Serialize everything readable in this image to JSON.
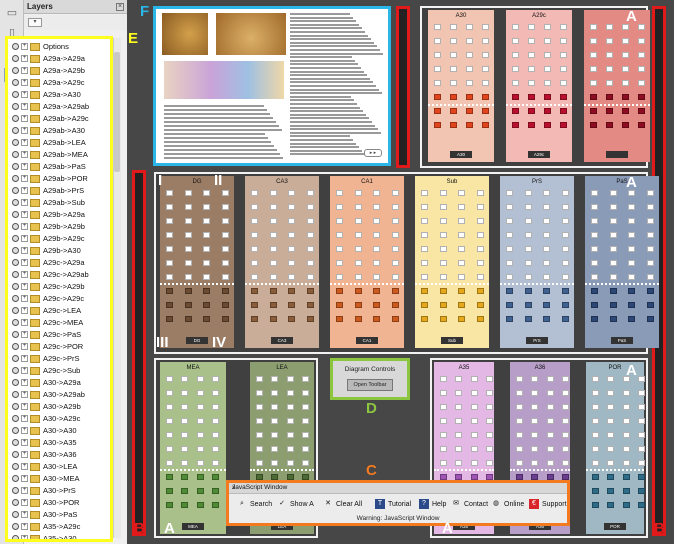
{
  "layers_panel": {
    "title": "Layers",
    "close": "×",
    "options_icon": "options-menu-icon",
    "items": [
      "Options",
      "A29a->A29a",
      "A29a->A29b",
      "A29a->A29c",
      "A29a->A30",
      "A29a->A29ab",
      "A29ab->A29c",
      "A29ab->A30",
      "A29ab->LEA",
      "A29ab->MEA",
      "A29ab->PaS",
      "A29ab->POR",
      "A29ab->PrS",
      "A29ab->Sub",
      "A29b->A29a",
      "A29b->A29b",
      "A29b->A29c",
      "A29b->A30",
      "A29c->A29a",
      "A29c->A29ab",
      "A29c->A29b",
      "A29c->A29c",
      "A29c->LEA",
      "A29c->MEA",
      "A29c->PaS",
      "A29c->POR",
      "A29c->PrS",
      "A29c->Sub",
      "A30->A29a",
      "A30->A29ab",
      "A30->A29b",
      "A30->A29c",
      "A30->A30",
      "A30->A35",
      "A30->A36",
      "A30->LEA",
      "A30->MEA",
      "A30->PrS",
      "A30->POR",
      "A30->PaS",
      "A35->A29c",
      "A35->A30"
    ]
  },
  "annotations": {
    "E": "E",
    "F": "F",
    "A": "A",
    "B": "B",
    "C": "C",
    "D": "D",
    "I": "I",
    "II": "II",
    "III": "III",
    "IV": "IV"
  },
  "columns_top": [
    {
      "label": "A30",
      "color": "#f2c4b2",
      "cell": "#e0451e"
    },
    {
      "label": "A29c",
      "color": "#f3b9b4",
      "cell": "#b8102d"
    },
    {
      "label": "",
      "color": "#e38a85",
      "cell": "#8e0d20"
    }
  ],
  "columns_mid": [
    {
      "label": "DG",
      "color": "#9b7d66",
      "cell": "#6b4a32"
    },
    {
      "label": "CA3",
      "color": "#c9ad98",
      "cell": "#8a5d3a"
    },
    {
      "label": "CA1",
      "color": "#f0b493",
      "cell": "#cc5a1e"
    },
    {
      "label": "Sub",
      "color": "#f9e6a4",
      "cell": "#e5a81c"
    },
    {
      "label": "PrS",
      "color": "#b3bfd2",
      "cell": "#40618f"
    },
    {
      "label": "PaS",
      "color": "#8a9bb8",
      "cell": "#2c4776"
    }
  ],
  "columns_bottom": [
    {
      "label": "MEA",
      "color": "#a9c08a",
      "cell": "#4f8a35"
    },
    {
      "label": "LEA",
      "color": "#8c9e70",
      "cell": "#4c6a33"
    },
    {
      "label": "A35",
      "color": "#e3b8e4",
      "cell": "#a055b6"
    },
    {
      "label": "A36",
      "color": "#b79ec9",
      "cell": "#6b3d8e"
    },
    {
      "label": "POR",
      "color": "#9fb8c4",
      "cell": "#2d6b86"
    }
  ],
  "side_labels": {
    "left": "projection",
    "right": "projection"
  },
  "diagram_controls": {
    "title": "Diagram Controls",
    "button": "Open Toolbar"
  },
  "js_window": {
    "title": "JavaScript Window",
    "close": "x",
    "buttons": [
      {
        "label": "Search",
        "icon": "search-icon"
      },
      {
        "label": "Show A",
        "icon": "checkmark-icon"
      },
      {
        "label": "Clear All",
        "icon": "clear-x-icon"
      },
      {
        "label": "Tutorial",
        "icon": "tutorial-icon"
      },
      {
        "label": "Help",
        "icon": "help-icon"
      },
      {
        "label": "Contact",
        "icon": "envelope-icon"
      },
      {
        "label": "Online",
        "icon": "globe-icon"
      },
      {
        "label": "Support",
        "icon": "support-icon"
      }
    ],
    "warning": "Warning: JavaScript Window"
  },
  "colors": {
    "yellow": "#ffff1e",
    "cyan": "#2bb6e8",
    "red": "#e01a1a",
    "orange": "#f47a20",
    "green": "#8cc63f"
  }
}
